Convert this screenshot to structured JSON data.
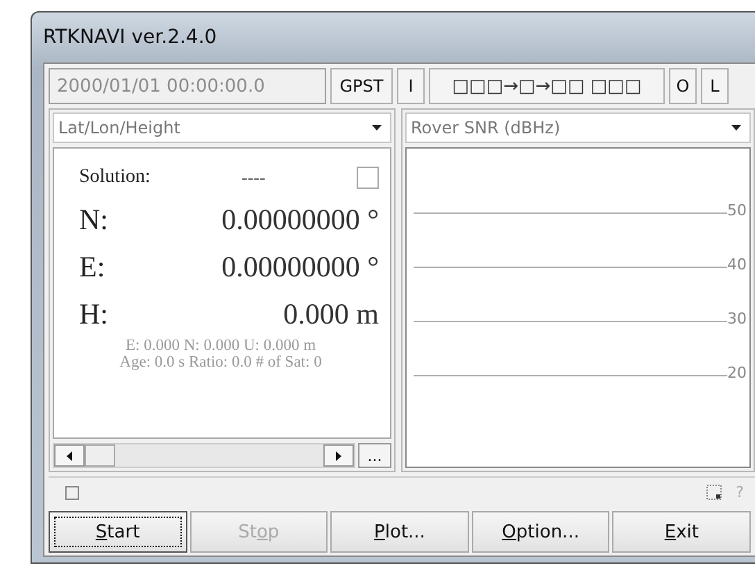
{
  "window": {
    "title": "RTKNAVI ver.2.4.0"
  },
  "toolbar": {
    "time": "2000/01/01 00:00:00.0",
    "time_system": "GPST",
    "input_button": "I",
    "stream_status": "□□□→□→□□ □□□",
    "output_button": "O",
    "log_button": "L"
  },
  "solution_panel": {
    "mode": "Lat/Lon/Height",
    "solution_label": "Solution:",
    "solution_value": "----",
    "rows": [
      {
        "label": "N:",
        "value": "0.00000000 °"
      },
      {
        "label": "E:",
        "value": "0.00000000 °"
      },
      {
        "label": "H:",
        "value": "0.000 m"
      }
    ],
    "deviation": "E: 0.000 N: 0.000 U: 0.000 m",
    "stats": "Age: 0.0 s Ratio: 0.0 # of Sat: 0",
    "more_button": "..."
  },
  "snr_panel": {
    "mode": "Rover SNR (dBHz)",
    "ticks": [
      "50",
      "40",
      "30",
      "20"
    ]
  },
  "status_bar": {
    "help": "?"
  },
  "buttons": [
    {
      "accel": "S",
      "after": "tart",
      "disabled": false,
      "focused": true
    },
    {
      "before": "St",
      "accel": "o",
      "after": "p",
      "disabled": true,
      "focused": false
    },
    {
      "accel": "P",
      "after": "lot...",
      "disabled": false,
      "focused": false
    },
    {
      "accel": "O",
      "after": "ption...",
      "disabled": false,
      "focused": false
    },
    {
      "accel": "E",
      "after": "xit",
      "disabled": false,
      "focused": false
    }
  ]
}
